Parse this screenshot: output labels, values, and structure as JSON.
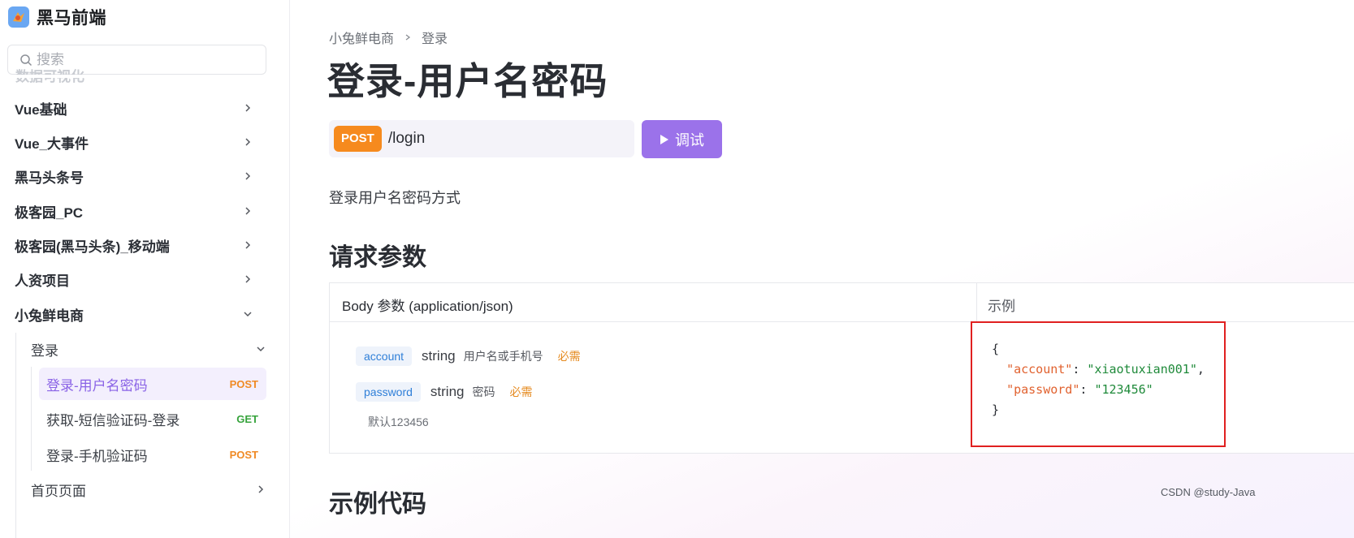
{
  "brand": {
    "name": "黑马前端"
  },
  "search": {
    "placeholder": "搜索"
  },
  "sidebar": {
    "clipped_item": "数据可视化",
    "items": [
      {
        "label": "Vue基础"
      },
      {
        "label": "Vue_大事件"
      },
      {
        "label": "黑马头条号"
      },
      {
        "label": "极客园_PC"
      },
      {
        "label": "极客园(黑马头条)_移动端"
      },
      {
        "label": "人资项目"
      },
      {
        "label": "小兔鲜电商"
      }
    ],
    "sub_group": {
      "label": "登录"
    },
    "leaves": [
      {
        "label": "登录-用户名密码",
        "method": "POST"
      },
      {
        "label": "获取-短信验证码-登录",
        "method": "GET"
      },
      {
        "label": "登录-手机验证码",
        "method": "POST"
      }
    ],
    "next_group": {
      "label": "首页页面"
    }
  },
  "breadcrumb": {
    "parent": "小兔鲜电商",
    "current": "登录"
  },
  "page": {
    "title": "登录-用户名密码",
    "method": "POST",
    "path": "/login",
    "debug_label": "调试",
    "description": "登录用户名密码方式",
    "section_params": "请求参数",
    "section_code": "示例代码"
  },
  "params": {
    "body_header": "Body 参数 (application/json)",
    "example_header": "示例",
    "rows": [
      {
        "name": "account",
        "type": "string",
        "desc": "用户名或手机号",
        "required": "必需"
      },
      {
        "name": "password",
        "type": "string",
        "desc": "密码",
        "required": "必需"
      }
    ],
    "default_note": "默认123456"
  },
  "example": {
    "open": "{",
    "key1": "\"account\"",
    "val1": "\"xiaotuxian001\"",
    "key2": "\"password\"",
    "val2": "\"123456\"",
    "close": "}"
  },
  "watermark": "CSDN @study-Java",
  "colors": {
    "accent": "#9b72ea",
    "post": "#f08a24",
    "get": "#36a33c",
    "highlight_border": "#e02020"
  }
}
